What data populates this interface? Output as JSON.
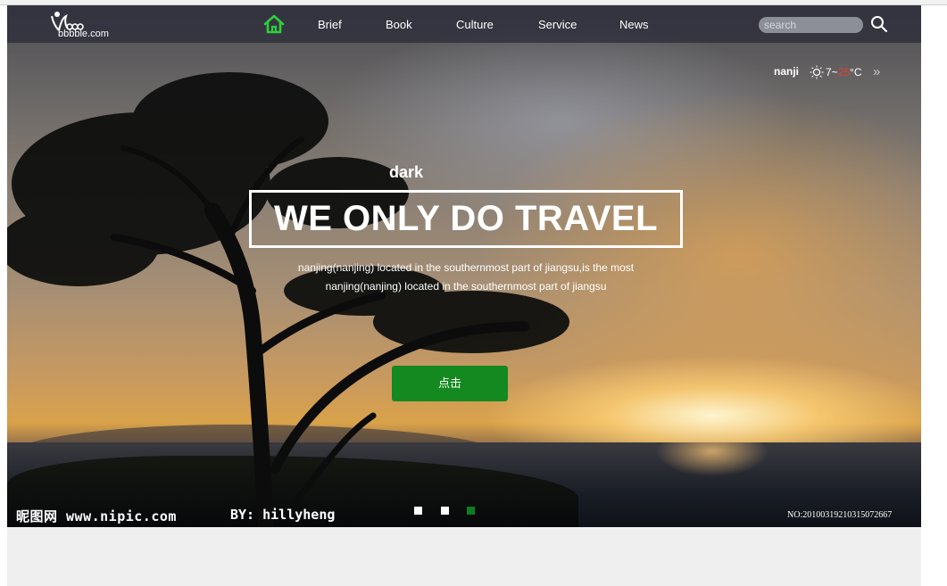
{
  "nav": {
    "logo_text": "bbbble.com",
    "items": [
      {
        "label": "Brief"
      },
      {
        "label": "Book"
      },
      {
        "label": "Culture"
      },
      {
        "label": "Service"
      },
      {
        "label": "News"
      }
    ],
    "search_placeholder": "search"
  },
  "weather": {
    "city": "nanji",
    "temp_low": "7~",
    "temp_high": "25",
    "unit": "°C"
  },
  "hero": {
    "tagline": "dark",
    "title": "WE ONLY DO TRAVEL",
    "desc_line1": "nanjing(nanjing) located in the southernmost part of jiangsu,is the most",
    "desc_line2": "nanjing(nanjing) located in the southernmost part of jiangsu",
    "cta_label": "点击"
  },
  "carousel": {
    "active_index": 2
  },
  "watermark": {
    "site": "昵图网 www.nipic.com",
    "author": "BY: hillyheng",
    "serial": "NO:20100319210315072667"
  },
  "colors": {
    "accent": "#14891f",
    "home_icon": "#2ecf3a",
    "temp_high": "#e33b3b"
  }
}
